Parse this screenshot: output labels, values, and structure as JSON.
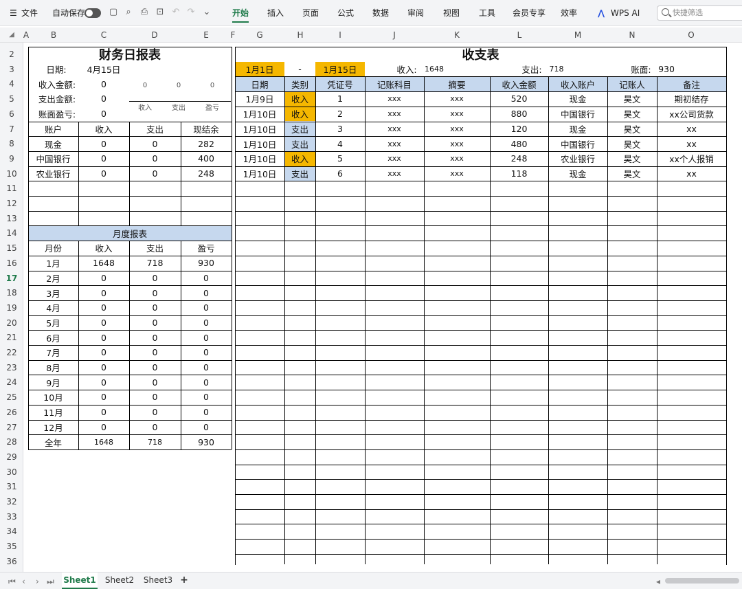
{
  "toolbar": {
    "menu_icon": "hamburger-icon",
    "file_label": "文件",
    "autosave_label": "自动保存",
    "tabs": [
      "开始",
      "插入",
      "页面",
      "公式",
      "数据",
      "审阅",
      "视图",
      "工具",
      "会员专享",
      "效率"
    ],
    "active_tab": "开始",
    "wps_ai_label": "WPS AI",
    "search_placeholder": "快捷筛选",
    "accent_color": "#1f7a4a"
  },
  "columns": [
    "A",
    "B",
    "C",
    "D",
    "E",
    "F",
    "G",
    "H",
    "I",
    "J",
    "K",
    "L",
    "M",
    "N",
    "O"
  ],
  "rows": [
    2,
    3,
    4,
    5,
    6,
    7,
    8,
    9,
    10,
    11,
    12,
    13,
    14,
    15,
    16,
    17,
    18,
    19,
    20,
    21,
    22,
    23,
    24,
    25,
    26,
    27,
    28,
    29,
    30,
    31,
    32,
    33,
    34,
    35,
    36
  ],
  "selected_row": 17,
  "daily": {
    "title": "财务日报表",
    "date_label": "日期:",
    "date_value": "4月15日",
    "income_label": "收入金额:",
    "income_value": "0",
    "expense_label": "支出金额:",
    "expense_value": "0",
    "balance_label": "账面盈亏:",
    "balance_value": "0",
    "mini_chart": {
      "values": [
        "0",
        "0",
        "0"
      ],
      "labels": [
        "收入",
        "支出",
        "盈亏"
      ]
    },
    "account_headers": [
      "账户",
      "收入",
      "支出",
      "现结余"
    ],
    "accounts": [
      [
        "现金",
        "0",
        "0",
        "282"
      ],
      [
        "中国银行",
        "0",
        "0",
        "400"
      ],
      [
        "农业银行",
        "0",
        "0",
        "248"
      ]
    ]
  },
  "monthly": {
    "title": "月度报表",
    "headers": [
      "月份",
      "收入",
      "支出",
      "盈亏"
    ],
    "rows": [
      [
        "1月",
        "1648",
        "718",
        "930"
      ],
      [
        "2月",
        "0",
        "0",
        "0"
      ],
      [
        "3月",
        "0",
        "0",
        "0"
      ],
      [
        "4月",
        "0",
        "0",
        "0"
      ],
      [
        "5月",
        "0",
        "0",
        "0"
      ],
      [
        "6月",
        "0",
        "0",
        "0"
      ],
      [
        "7月",
        "0",
        "0",
        "0"
      ],
      [
        "8月",
        "0",
        "0",
        "0"
      ],
      [
        "9月",
        "0",
        "0",
        "0"
      ],
      [
        "10月",
        "0",
        "0",
        "0"
      ],
      [
        "11月",
        "0",
        "0",
        "0"
      ],
      [
        "12月",
        "0",
        "0",
        "0"
      ]
    ],
    "total": [
      "全年",
      "1648",
      "718",
      "930"
    ]
  },
  "ledger": {
    "title": "收支表",
    "start_date": "1月1日",
    "dash": "-",
    "end_date": "1月15日",
    "income_label": "收入:",
    "income_value": "1648",
    "expense_label": "支出:",
    "expense_value": "718",
    "balance_label": "账面:",
    "balance_value": "930",
    "headers": [
      "日期",
      "类别",
      "凭证号",
      "记账科目",
      "摘要",
      "收入金额",
      "收入账户",
      "记账人",
      "备注"
    ],
    "rows": [
      [
        "1月9日",
        "收入",
        "1",
        "xxx",
        "xxx",
        "520",
        "现金",
        "昊文",
        "期初结存"
      ],
      [
        "1月10日",
        "收入",
        "2",
        "xxx",
        "xxx",
        "880",
        "中国银行",
        "昊文",
        "xx公司货款"
      ],
      [
        "1月10日",
        "支出",
        "3",
        "xxx",
        "xxx",
        "120",
        "现金",
        "昊文",
        "xx"
      ],
      [
        "1月10日",
        "支出",
        "4",
        "xxx",
        "xxx",
        "480",
        "中国银行",
        "昊文",
        "xx"
      ],
      [
        "1月10日",
        "收入",
        "5",
        "xxx",
        "xxx",
        "248",
        "农业银行",
        "昊文",
        "xx个人报销"
      ],
      [
        "1月10日",
        "支出",
        "6",
        "xxx",
        "xxx",
        "118",
        "现金",
        "昊文",
        "xx"
      ]
    ],
    "income_color": "#f5b700",
    "expense_color": "#c6d8ee"
  },
  "sheet_tabs": [
    "Sheet1",
    "Sheet2",
    "Sheet3"
  ],
  "active_sheet": "Sheet1",
  "add_sheet_label": "+"
}
